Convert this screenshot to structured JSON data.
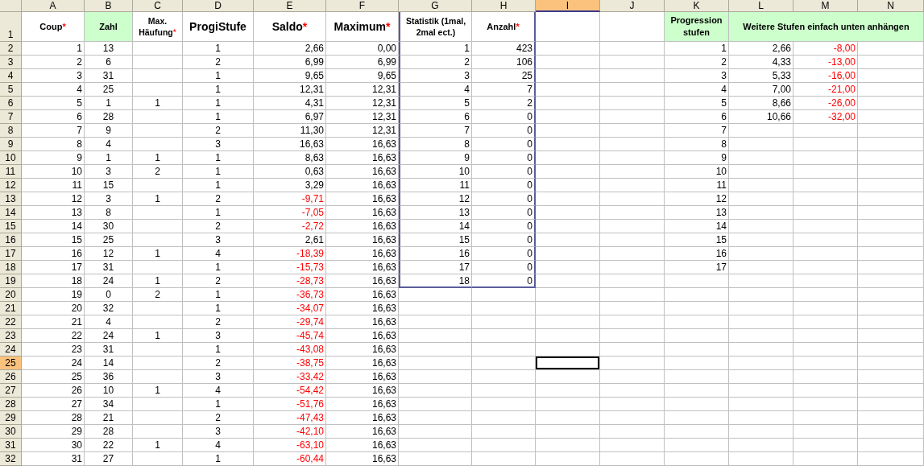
{
  "columns": [
    {
      "label": "A",
      "selected": false
    },
    {
      "label": "B",
      "selected": false
    },
    {
      "label": "C",
      "selected": false
    },
    {
      "label": "D",
      "selected": false
    },
    {
      "label": "E",
      "selected": false
    },
    {
      "label": "F",
      "selected": false
    },
    {
      "label": "G",
      "selected": false
    },
    {
      "label": "H",
      "selected": false
    },
    {
      "label": "I",
      "selected": true
    },
    {
      "label": "J",
      "selected": false
    },
    {
      "label": "K",
      "selected": false
    },
    {
      "label": "L",
      "selected": false
    },
    {
      "label": "M",
      "selected": false
    },
    {
      "label": "N",
      "selected": false
    }
  ],
  "header_row": {
    "number": "1",
    "cells": [
      {
        "text": "Coup",
        "mark": "*",
        "highlighted": false
      },
      {
        "text": "Zahl",
        "highlighted": true
      },
      {
        "text": "Max. Häufung",
        "mark": "*",
        "highlighted": false
      },
      {
        "text": "ProgiStufe",
        "highlighted": false
      },
      {
        "text": "Saldo",
        "mark": "*",
        "highlighted": false
      },
      {
        "text": "Maximum",
        "mark": "*",
        "highlighted": false
      },
      {
        "text": "**Statistik** (1mal, 2mal ect.)",
        "highlighted": false
      },
      {
        "text": "Anzahl",
        "mark": "*",
        "highlighted": false
      },
      {
        "text": "Progression stufen",
        "highlighted": true
      },
      {
        "text": "Weitere Stufen einfach unten anhängen",
        "highlighted": true
      }
    ]
  },
  "rows": [
    {
      "number": "2",
      "selected": false,
      "coup": "1",
      "zahl": "13",
      "progi_stufe": "1",
      "saldo": "2,66",
      "saldo_negative": false,
      "maximum": "0,00",
      "statistik": "1",
      "anzahl": "423",
      "progression_stufe": "1",
      "weitere_stufen_1": "2,66",
      "weitere_stufen_2": "-8,00",
      "weitere_stufen_2_negative": true
    },
    {
      "number": "3",
      "selected": false,
      "coup": "2",
      "zahl": "6",
      "progi_stufe": "2",
      "saldo": "6,99",
      "saldo_negative": false,
      "maximum": "6,99",
      "statistik": "2",
      "anzahl": "106",
      "progression_stufe": "2",
      "weitere_stufen_1": "4,33",
      "weitere_stufen_2": "-13,00",
      "weitere_stufen_2_negative": true
    },
    {
      "number": "4",
      "selected": false,
      "coup": "3",
      "zahl": "31",
      "progi_stufe": "1",
      "saldo": "9,65",
      "saldo_negative": false,
      "maximum": "9,65",
      "statistik": "3",
      "anzahl": "25",
      "progression_stufe": "3",
      "weitere_stufen_1": "5,33",
      "weitere_stufen_2": "-16,00",
      "weitere_stufen_2_negative": true
    },
    {
      "number": "5",
      "selected": false,
      "coup": "4",
      "zahl": "25",
      "progi_stufe": "1",
      "saldo": "12,31",
      "saldo_negative": false,
      "maximum": "12,31",
      "statistik": "4",
      "anzahl": "7",
      "progression_stufe": "4",
      "weitere_stufen_1": "7,00",
      "weitere_stufen_2": "-21,00",
      "weitere_stufen_2_negative": true
    },
    {
      "number": "6",
      "selected": false,
      "coup": "5",
      "zahl": "1",
      "max_haeufung": "1",
      "progi_stufe": "1",
      "saldo": "4,31",
      "saldo_negative": false,
      "maximum": "12,31",
      "statistik": "5",
      "anzahl": "2",
      "progression_stufe": "5",
      "weitere_stufen_1": "8,66",
      "weitere_stufen_2": "-26,00",
      "weitere_stufen_2_negative": true
    },
    {
      "number": "7",
      "selected": false,
      "coup": "6",
      "zahl": "28",
      "progi_stufe": "1",
      "saldo": "6,97",
      "saldo_negative": false,
      "maximum": "12,31",
      "statistik": "6",
      "anzahl": "0",
      "progression_stufe": "6",
      "weitere_stufen_1": "10,66",
      "weitere_stufen_2": "-32,00",
      "weitere_stufen_2_negative": true
    },
    {
      "number": "8",
      "selected": false,
      "coup": "7",
      "zahl": "9",
      "progi_stufe": "2",
      "saldo": "11,30",
      "saldo_negative": false,
      "maximum": "12,31",
      "statistik": "7",
      "anzahl": "0",
      "progression_stufe": "7"
    },
    {
      "number": "9",
      "selected": false,
      "coup": "8",
      "zahl": "4",
      "progi_stufe": "3",
      "saldo": "16,63",
      "saldo_negative": false,
      "maximum": "16,63",
      "statistik": "8",
      "anzahl": "0",
      "progression_stufe": "8"
    },
    {
      "number": "10",
      "selected": false,
      "coup": "9",
      "zahl": "1",
      "max_haeufung": "1",
      "progi_stufe": "1",
      "saldo": "8,63",
      "saldo_negative": false,
      "maximum": "16,63",
      "statistik": "9",
      "anzahl": "0",
      "progression_stufe": "9"
    },
    {
      "number": "11",
      "selected": false,
      "coup": "10",
      "zahl": "3",
      "max_haeufung": "2",
      "progi_stufe": "1",
      "saldo": "0,63",
      "saldo_negative": false,
      "maximum": "16,63",
      "statistik": "10",
      "anzahl": "0",
      "progression_stufe": "10"
    },
    {
      "number": "12",
      "selected": false,
      "coup": "11",
      "zahl": "15",
      "progi_stufe": "1",
      "saldo": "3,29",
      "saldo_negative": false,
      "maximum": "16,63",
      "statistik": "11",
      "anzahl": "0",
      "progression_stufe": "11"
    },
    {
      "number": "13",
      "selected": false,
      "coup": "12",
      "zahl": "3",
      "max_haeufung": "1",
      "progi_stufe": "2",
      "saldo": "-9,71",
      "saldo_negative": true,
      "maximum": "16,63",
      "statistik": "12",
      "anzahl": "0",
      "progression_stufe": "12"
    },
    {
      "number": "14",
      "selected": false,
      "coup": "13",
      "zahl": "8",
      "progi_stufe": "1",
      "saldo": "-7,05",
      "saldo_negative": true,
      "maximum": "16,63",
      "statistik": "13",
      "anzahl": "0",
      "progression_stufe": "13"
    },
    {
      "number": "15",
      "selected": false,
      "coup": "14",
      "zahl": "30",
      "progi_stufe": "2",
      "saldo": "-2,72",
      "saldo_negative": true,
      "maximum": "16,63",
      "statistik": "14",
      "anzahl": "0",
      "progression_stufe": "14"
    },
    {
      "number": "16",
      "selected": false,
      "coup": "15",
      "zahl": "25",
      "progi_stufe": "3",
      "saldo": "2,61",
      "saldo_negative": false,
      "maximum": "16,63",
      "statistik": "15",
      "anzahl": "0",
      "progression_stufe": "15"
    },
    {
      "number": "17",
      "selected": false,
      "coup": "16",
      "zahl": "12",
      "max_haeufung": "1",
      "progi_stufe": "4",
      "saldo": "-18,39",
      "saldo_negative": true,
      "maximum": "16,63",
      "statistik": "16",
      "anzahl": "0",
      "progression_stufe": "16"
    },
    {
      "number": "18",
      "selected": false,
      "coup": "17",
      "zahl": "31",
      "progi_stufe": "1",
      "saldo": "-15,73",
      "saldo_negative": true,
      "maximum": "16,63",
      "statistik": "17",
      "anzahl": "0",
      "progression_stufe": "17"
    },
    {
      "number": "19",
      "selected": false,
      "coup": "18",
      "zahl": "24",
      "max_haeufung": "1",
      "progi_stufe": "2",
      "saldo": "-28,73",
      "saldo_negative": true,
      "maximum": "16,63",
      "statistik": "18",
      "anzahl": "0"
    },
    {
      "number": "20",
      "selected": false,
      "coup": "19",
      "zahl": "0",
      "max_haeufung": "2",
      "progi_stufe": "1",
      "saldo": "-36,73",
      "saldo_negative": true,
      "maximum": "16,63"
    },
    {
      "number": "21",
      "selected": false,
      "coup": "20",
      "zahl": "32",
      "progi_stufe": "1",
      "saldo": "-34,07",
      "saldo_negative": true,
      "maximum": "16,63"
    },
    {
      "number": "22",
      "selected": false,
      "coup": "21",
      "zahl": "4",
      "progi_stufe": "2",
      "saldo": "-29,74",
      "saldo_negative": true,
      "maximum": "16,63"
    },
    {
      "number": "23",
      "selected": false,
      "coup": "22",
      "zahl": "24",
      "max_haeufung": "1",
      "progi_stufe": "3",
      "saldo": "-45,74",
      "saldo_negative": true,
      "maximum": "16,63"
    },
    {
      "number": "24",
      "selected": false,
      "coup": "23",
      "zahl": "31",
      "progi_stufe": "1",
      "saldo": "-43,08",
      "saldo_negative": true,
      "maximum": "16,63"
    },
    {
      "number": "25",
      "selected": true,
      "coup": "24",
      "zahl": "14",
      "progi_stufe": "2",
      "saldo": "-38,75",
      "saldo_negative": true,
      "maximum": "16,63"
    },
    {
      "number": "26",
      "selected": false,
      "coup": "25",
      "zahl": "36",
      "progi_stufe": "3",
      "saldo": "-33,42",
      "saldo_negative": true,
      "maximum": "16,63"
    },
    {
      "number": "27",
      "selected": false,
      "coup": "26",
      "zahl": "10",
      "max_haeufung": "1",
      "progi_stufe": "4",
      "saldo": "-54,42",
      "saldo_negative": true,
      "maximum": "16,63"
    },
    {
      "number": "28",
      "selected": false,
      "coup": "27",
      "zahl": "34",
      "progi_stufe": "1",
      "saldo": "-51,76",
      "saldo_negative": true,
      "maximum": "16,63"
    },
    {
      "number": "29",
      "selected": false,
      "coup": "28",
      "zahl": "21",
      "progi_stufe": "2",
      "saldo": "-47,43",
      "saldo_negative": true,
      "maximum": "16,63"
    },
    {
      "number": "30",
      "selected": false,
      "coup": "29",
      "zahl": "28",
      "progi_stufe": "3",
      "saldo": "-42,10",
      "saldo_negative": true,
      "maximum": "16,63"
    },
    {
      "number": "31",
      "selected": false,
      "coup": "30",
      "zahl": "22",
      "max_haeufung": "1",
      "progi_stufe": "4",
      "saldo": "-63,10",
      "saldo_negative": true,
      "maximum": "16,63"
    },
    {
      "number": "32",
      "selected": false,
      "coup": "31",
      "zahl": "27",
      "progi_stufe": "1",
      "saldo": "-60,44",
      "saldo_negative": true,
      "maximum": "16,63"
    }
  ]
}
